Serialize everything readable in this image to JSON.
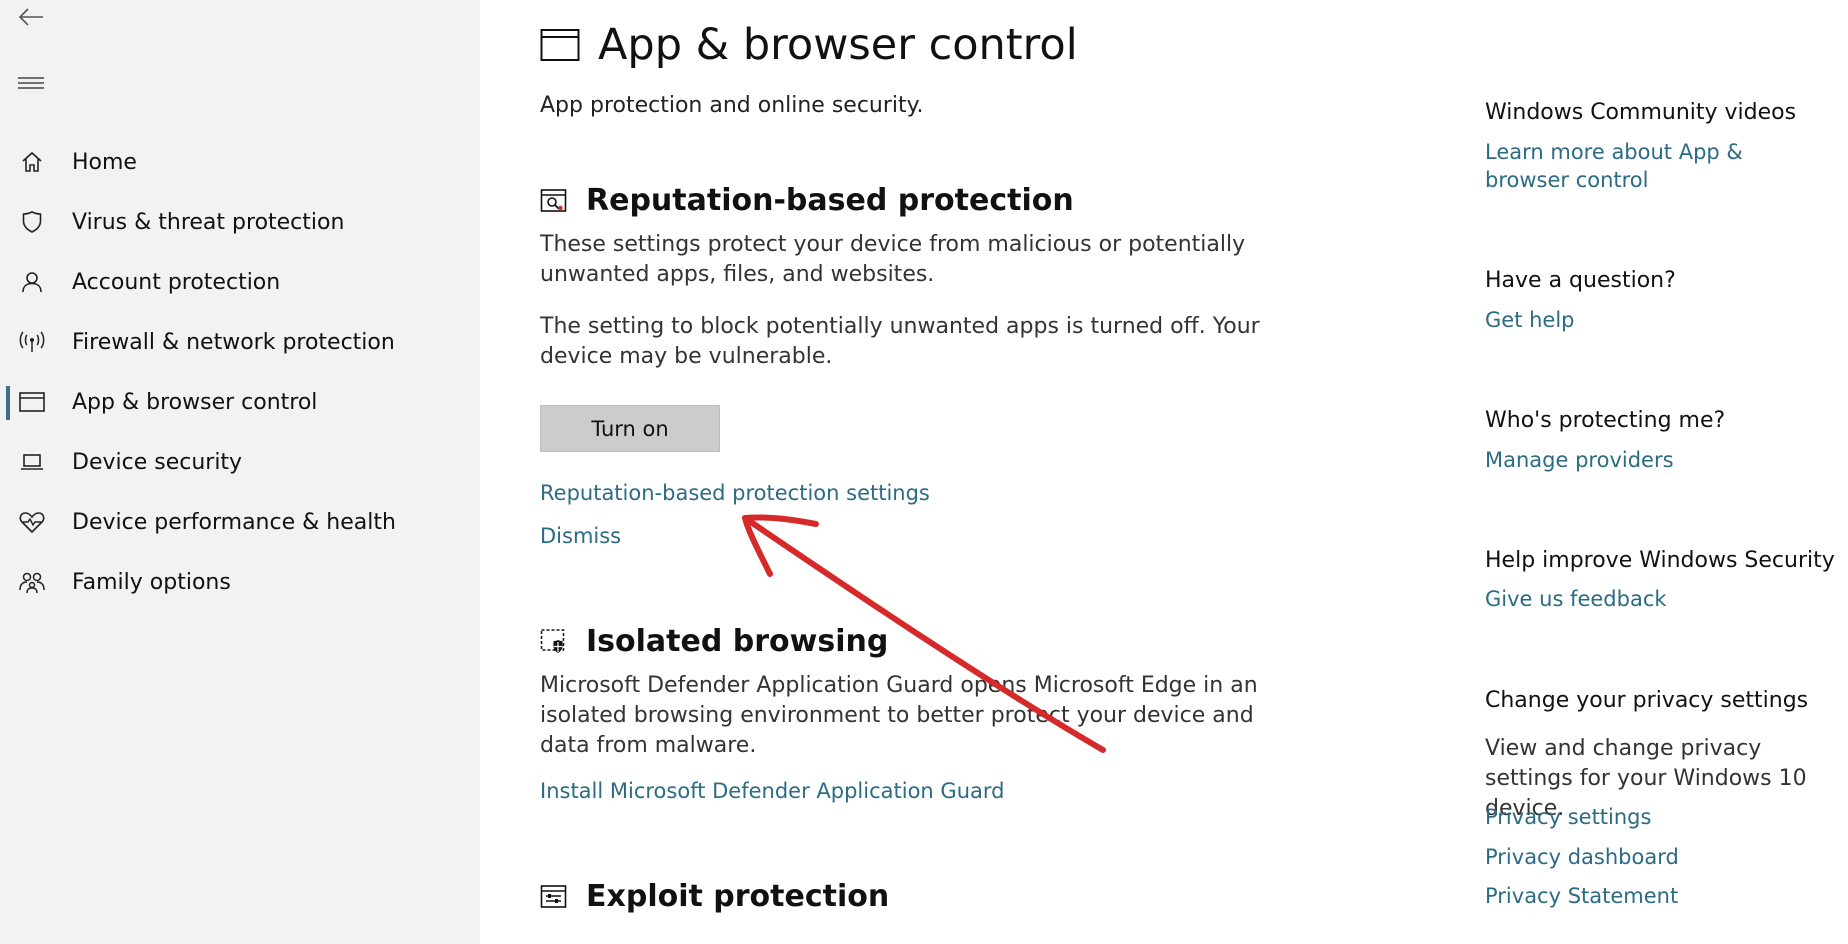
{
  "sidebar": {
    "back_icon": "back-arrow-icon",
    "menu_icon": "hamburger-menu-icon",
    "items": [
      {
        "label": "Home",
        "icon": "home-icon"
      },
      {
        "label": "Virus & threat protection",
        "icon": "shield-icon"
      },
      {
        "label": "Account protection",
        "icon": "person-icon"
      },
      {
        "label": "Firewall & network protection",
        "icon": "wireless-icon"
      },
      {
        "label": "App & browser control",
        "icon": "app-window-icon",
        "selected": true
      },
      {
        "label": "Device security",
        "icon": "laptop-icon"
      },
      {
        "label": "Device performance & health",
        "icon": "heart-pulse-icon"
      },
      {
        "label": "Family options",
        "icon": "family-icon"
      }
    ]
  },
  "main": {
    "title": "App & browser control",
    "subtitle": "App protection and online security.",
    "reputation": {
      "title": "Reputation-based protection",
      "desc": "These settings protect your device from malicious or potentially unwanted apps, files, and websites.",
      "warning": "The setting to block potentially unwanted apps is turned off. Your device may be vulnerable.",
      "button": "Turn on",
      "settings_link": "Reputation-based protection settings",
      "dismiss_link": "Dismiss"
    },
    "isolated": {
      "title": "Isolated browsing",
      "desc": "Microsoft Defender Application Guard opens Microsoft Edge in an isolated browsing environment to better protect your device and data from malware.",
      "link": "Install Microsoft Defender Application Guard"
    },
    "exploit": {
      "title": "Exploit protection"
    }
  },
  "right": {
    "videos": {
      "heading": "Windows Community videos",
      "link": "Learn more about App & browser control"
    },
    "question": {
      "heading": "Have a question?",
      "link": "Get help"
    },
    "protecting": {
      "heading": "Who's protecting me?",
      "link": "Manage providers"
    },
    "improve": {
      "heading": "Help improve Windows Security",
      "link": "Give us feedback"
    },
    "privacy": {
      "heading": "Change your privacy settings",
      "text": "View and change privacy settings for your Windows 10 device.",
      "links": [
        "Privacy settings",
        "Privacy dashboard",
        "Privacy Statement"
      ]
    }
  },
  "colors": {
    "link": "#2b6b84",
    "sidebar_bg": "#f2f2f2",
    "button_bg": "#cccccc",
    "annotation_arrow": "#d62a2a"
  }
}
